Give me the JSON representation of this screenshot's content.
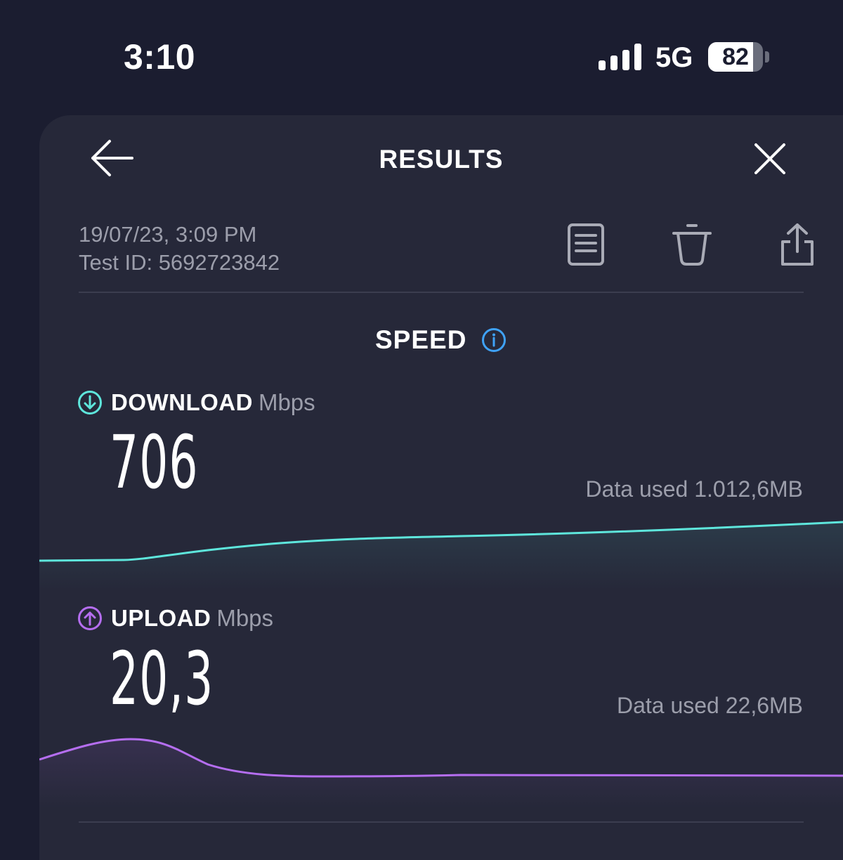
{
  "status_bar": {
    "time": "3:10",
    "network": "5G",
    "battery": "82"
  },
  "header": {
    "title": "RESULTS"
  },
  "test_info": {
    "date": "19/07/23, 3:09 PM",
    "test_id": "Test ID: 5692723842"
  },
  "speed": {
    "title": "SPEED",
    "download": {
      "label": "DOWNLOAD",
      "unit": "Mbps",
      "value": "706",
      "data_used": "Data used 1.012,6MB",
      "color": "#5ee6dc"
    },
    "upload": {
      "label": "UPLOAD",
      "unit": "Mbps",
      "value": "20,3",
      "data_used": "Data used 22,6MB",
      "color": "#b56ef0"
    }
  },
  "colors": {
    "background": "#1b1d30",
    "panel": "#262839",
    "info_accent": "#3fa2f7",
    "muted_text": "#9c9eab"
  },
  "icons": [
    "back-arrow-icon",
    "close-icon",
    "results-list-icon",
    "trash-icon",
    "share-icon",
    "info-icon",
    "download-arrow-icon",
    "upload-arrow-icon"
  ]
}
